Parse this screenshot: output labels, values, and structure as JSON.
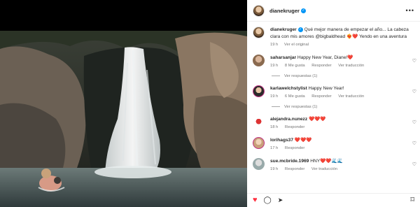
{
  "header": {
    "username": "dianekruger",
    "more_label": "•••"
  },
  "caption": {
    "username": "dianekruger",
    "text": "Qué mejor manera de empezar el año... La cabeza clara con mis amores @bigbaldhead ❤️‍🔥❤️ Yendo en una aventura",
    "time": "19 h",
    "translation": "Ver el original"
  },
  "comments": [
    {
      "username": "saharsanjar",
      "text": "Happy New Year, Diane!❤️",
      "time": "19 h",
      "likes": "8 Me gusta",
      "reply": "Responder",
      "translation": "Ver traducción",
      "replies": "Ver respuestas (1)"
    },
    {
      "username": "karlawelchstylist",
      "text": "Happy New Year!",
      "time": "19 h",
      "likes": "6 Me gusta",
      "reply": "Responder",
      "translation": "Ver traducción",
      "replies": "Ver respuestas (1)"
    },
    {
      "username": "alejandra.nunezz",
      "text": "❤️❤️❤️",
      "time": "18 h",
      "reply": "Responder"
    },
    {
      "username": "lorihags37",
      "text": "❤️❤️❤️",
      "time": "17 h",
      "reply": "Responder"
    },
    {
      "username": "sue.mcbride.1969",
      "text": "HNY❤️❤️🌊🌊",
      "time": "19 h",
      "reply": "Responder",
      "translation": "Ver traducción"
    }
  ],
  "actions": {
    "like": "♥",
    "comment": "◯",
    "share": "➤",
    "save": "⌑"
  },
  "colors": {
    "like_red": "#ff3040",
    "link_blue": "#00376b",
    "verified_blue": "#0095f6"
  }
}
